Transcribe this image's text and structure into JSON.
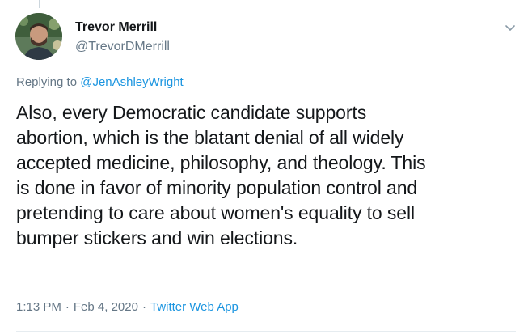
{
  "author": {
    "display_name": "Trevor Merrill",
    "handle": "@TrevorDMerrill"
  },
  "reply_context": {
    "prefix": "Replying to ",
    "to_handle": "@JenAshleyWright"
  },
  "tweet": {
    "lines": [
      "Also, every Democratic candidate supports",
      "abortion, which is the blatant denial of all widely",
      "accepted medicine, philosophy, and theology. This",
      "is done in favor of minority population control and",
      "pretending to care about women's equality to sell",
      "bumper stickers and win elections."
    ]
  },
  "meta": {
    "time": "1:13 PM",
    "separator": "·",
    "date": "Feb 4, 2020",
    "source": "Twitter Web App"
  },
  "icons": {
    "menu": "chevron-down-icon",
    "avatar": "avatar"
  },
  "colors": {
    "link": "#1b95e0",
    "secondary_text": "#657786",
    "primary_text": "#14171a",
    "divider": "#e6ecf0"
  }
}
